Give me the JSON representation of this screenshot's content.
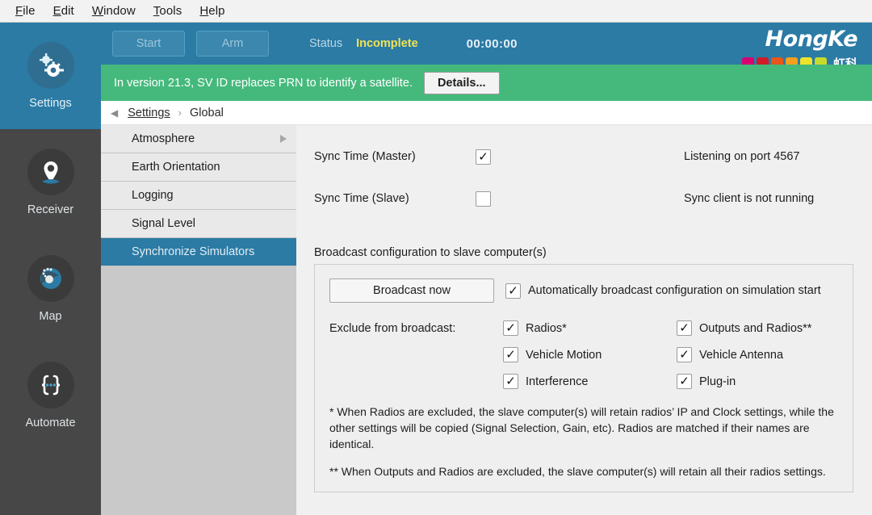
{
  "menubar": {
    "items": [
      {
        "pre": "F",
        "post": "ile"
      },
      {
        "pre": "E",
        "post": "dit"
      },
      {
        "pre": "W",
        "post": "indow"
      },
      {
        "pre": "T",
        "post": "ools"
      },
      {
        "pre": "H",
        "post": "elp"
      }
    ]
  },
  "rail": {
    "items": [
      {
        "label": "Settings",
        "icon": "gears-icon",
        "active": true
      },
      {
        "label": "Receiver",
        "icon": "location-pin-icon",
        "active": false
      },
      {
        "label": "Map",
        "icon": "globe-lens-icon",
        "active": false
      },
      {
        "label": "Automate",
        "icon": "curly-braces-icon",
        "active": false
      }
    ]
  },
  "toolbar": {
    "start_label": "Start",
    "arm_label": "Arm",
    "status_label": "Status",
    "status_value": "Incomplete",
    "status_color": "#f2e255",
    "timer": "00:00:00"
  },
  "logo": {
    "text": "HongKe",
    "chinese": "虹科",
    "squares": [
      "#d6006f",
      "#cf1c28",
      "#e8561a",
      "#f2a01e",
      "#efe32a",
      "#c6da2a"
    ]
  },
  "banner": {
    "message": "In version 21.3, SV ID replaces PRN to identify a satellite.",
    "button_label": "Details...",
    "background": "#45b97c"
  },
  "breadcrumb": {
    "back_icon": "back-arrow-icon",
    "root": "Settings",
    "separator": "›",
    "current": "Global"
  },
  "sublist": {
    "items": [
      {
        "label": "Atmosphere",
        "has_chevron": true,
        "selected": false
      },
      {
        "label": "Earth Orientation",
        "has_chevron": false,
        "selected": false
      },
      {
        "label": "Logging",
        "has_chevron": false,
        "selected": false
      },
      {
        "label": "Signal Level",
        "has_chevron": false,
        "selected": false
      },
      {
        "label": "Synchronize Simulators",
        "has_chevron": false,
        "selected": true
      }
    ]
  },
  "main": {
    "sync_master": {
      "label": "Sync Time (Master)",
      "checked": true,
      "status": "Listening on port 4567"
    },
    "sync_slave": {
      "label": "Sync Time (Slave)",
      "checked": false,
      "status": "Sync client is not running"
    },
    "group_title": "Broadcast configuration to slave computer(s)",
    "broadcast_now_label": "Broadcast now",
    "auto_broadcast": {
      "label": "Automatically broadcast configuration on simulation start",
      "checked": true
    },
    "exclude_label": "Exclude from broadcast:",
    "exclude_left": [
      {
        "label": "Radios*",
        "checked": true
      },
      {
        "label": "Vehicle Motion",
        "checked": true
      },
      {
        "label": "Interference",
        "checked": true
      }
    ],
    "exclude_right": [
      {
        "label": "Outputs and Radios**",
        "checked": true
      },
      {
        "label": "Vehicle Antenna",
        "checked": true
      },
      {
        "label": "Plug-in",
        "checked": true
      }
    ],
    "note_one": "* When Radios are excluded, the slave computer(s) will retain radios’ IP and Clock settings, while the other settings will be copied (Signal Selection, Gain, etc). Radios are matched if their names are identical.",
    "note_two": "** When Outputs and Radios are excluded, the slave computer(s) will retain all their radios settings."
  }
}
